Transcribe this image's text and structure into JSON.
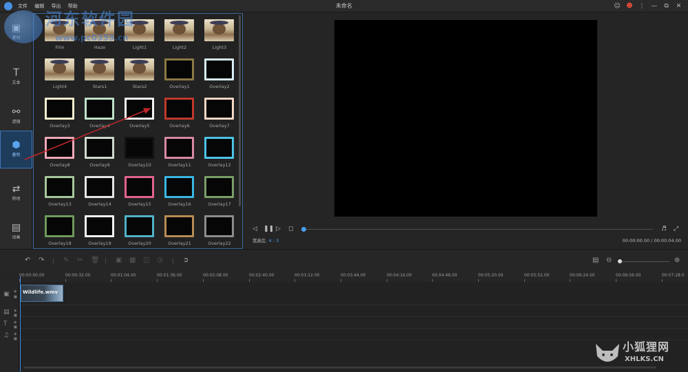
{
  "menu": [
    "文件",
    "编辑",
    "导出",
    "帮助"
  ],
  "window_title": "未命名",
  "sidebar": [
    {
      "label": "素材",
      "icon": "media-icon"
    },
    {
      "label": "文本",
      "icon": "text-icon"
    },
    {
      "label": "滤镜",
      "icon": "filter-icon"
    },
    {
      "label": "叠附",
      "icon": "overlay-icon",
      "active": true
    },
    {
      "label": "转场",
      "icon": "transition-icon"
    },
    {
      "label": "动画",
      "icon": "animation-icon"
    }
  ],
  "library": [
    {
      "label": "Film",
      "kind": "dog"
    },
    {
      "label": "Haze",
      "kind": "dog"
    },
    {
      "label": "Light1",
      "kind": "dog"
    },
    {
      "label": "Light2",
      "kind": "dog"
    },
    {
      "label": "Light3",
      "kind": "dog"
    },
    {
      "label": "Light4",
      "kind": "dog"
    },
    {
      "label": "Stars1",
      "kind": "dog"
    },
    {
      "label": "Stars2",
      "kind": "dog"
    },
    {
      "label": "Overlay1",
      "kind": "frame",
      "border": "#8a7a44"
    },
    {
      "label": "Overlay2",
      "kind": "frame",
      "border": "#d8ecf6"
    },
    {
      "label": "Overlay3",
      "kind": "frame",
      "border": "#f6eccd"
    },
    {
      "label": "Overlay4",
      "kind": "frame",
      "border": "#bfe2c9"
    },
    {
      "label": "Overlay5",
      "kind": "frame",
      "border": "#f4f4f4"
    },
    {
      "label": "Overlay6",
      "kind": "frame",
      "border": "#c0392b"
    },
    {
      "label": "Overlay7",
      "kind": "frame",
      "border": "#f3d6c4"
    },
    {
      "label": "Overlay8",
      "kind": "frame",
      "border": "#f0a8b8"
    },
    {
      "label": "Overlay9",
      "kind": "frame",
      "border": "#cfd9cf"
    },
    {
      "label": "Overlay10",
      "kind": "frame",
      "border": "#111111"
    },
    {
      "label": "Overlay11",
      "kind": "frame",
      "border": "#d889a2"
    },
    {
      "label": "Overlay12",
      "kind": "frame",
      "border": "#4cc3e6"
    },
    {
      "label": "Overlay13",
      "kind": "frame",
      "border": "#a6c79a"
    },
    {
      "label": "Overlay14",
      "kind": "frame",
      "border": "#e6e6e6"
    },
    {
      "label": "Overlay15",
      "kind": "frame",
      "border": "#e2638f"
    },
    {
      "label": "Overlay16",
      "kind": "frame",
      "border": "#38b7e3"
    },
    {
      "label": "Overlay17",
      "kind": "frame",
      "border": "#7a9f68"
    },
    {
      "label": "Overlay18",
      "kind": "frame",
      "border": "#6e9a5e"
    },
    {
      "label": "Overlay19",
      "kind": "frame",
      "border": "#f4f4f4"
    },
    {
      "label": "Overlay20",
      "kind": "frame",
      "border": "#4fb2c7"
    },
    {
      "label": "Overlay21",
      "kind": "frame",
      "border": "#b78b55"
    },
    {
      "label": "Overlay22",
      "kind": "frame",
      "border": "#8c8c8c"
    }
  ],
  "player": {
    "aspect_label": "宽高比",
    "aspect_value": "4 : 3",
    "timecode": "00:00:00.00 / 00:00:04.00"
  },
  "ruler": [
    "00:00:00.00",
    "00:00:32.00",
    "00:01:04.00",
    "00:01:36.00",
    "00:02:08.00",
    "00:02:40.00",
    "00:03:12.00",
    "00:03:44.00",
    "00:04:16.00",
    "00:04:48.00",
    "00:05:20.00",
    "00:05:52.00",
    "00:06:24.00",
    "00:06:56.00",
    "00:07:28.0"
  ],
  "clip": {
    "name": "Wildlife.wmv"
  },
  "watermark": {
    "top_left": "河东软件园",
    "top_left_url": "www.pc0359.cn",
    "bottom_right": "小狐狸网",
    "bottom_right_url": "XHLKS.CN"
  }
}
